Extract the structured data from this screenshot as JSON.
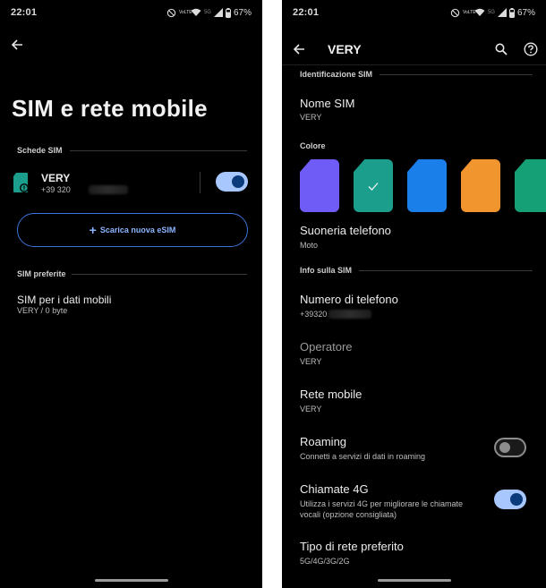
{
  "status_bar": {
    "time": "22:01",
    "battery": "67%",
    "network": "5G",
    "volte": "VoLTE"
  },
  "left_screen": {
    "title": "SIM e rete mobile",
    "sim_cards_section": "Schede SIM",
    "sim": {
      "name": "VERY",
      "number_prefix": "+39 320",
      "enabled": true
    },
    "download_esim_label": "Scarica nuova eSIM",
    "preferred_section": "SIM preferite",
    "mobile_data_sim": {
      "title": "SIM per i dati mobili",
      "value": "VERY / 0 byte"
    }
  },
  "right_screen": {
    "title": "VERY",
    "sim_id_section": "Identificazione SIM",
    "sim_name": {
      "title": "Nome SIM",
      "value": "VERY"
    },
    "color_section": "Colore",
    "colors": [
      {
        "name": "purple",
        "hex": "#6f5cf6",
        "selected": false
      },
      {
        "name": "teal",
        "hex": "#1b9e8c",
        "selected": true
      },
      {
        "name": "blue",
        "hex": "#1a7fe8",
        "selected": false
      },
      {
        "name": "orange",
        "hex": "#f1962f",
        "selected": false
      },
      {
        "name": "green",
        "hex": "#15a076",
        "selected": false
      }
    ],
    "ringtone": {
      "title": "Suoneria telefono",
      "value": "Moto"
    },
    "sim_info_section": "Info sulla SIM",
    "phone_number": {
      "title": "Numero di telefono",
      "value": "+39320"
    },
    "operator": {
      "title": "Operatore",
      "value": "VERY"
    },
    "mobile_network": {
      "title": "Rete mobile",
      "value": "VERY"
    },
    "roaming": {
      "title": "Roaming",
      "value": "Connetti a servizi di dati in roaming",
      "enabled": false
    },
    "calls_4g": {
      "title": "Chiamate 4G",
      "value": "Utilizza i servizi 4G per migliorare le chiamate vocali (opzione consigliata)",
      "enabled": true
    },
    "preferred_network": {
      "title": "Tipo di rete preferito",
      "value": "5G/4G/3G/2G"
    }
  }
}
